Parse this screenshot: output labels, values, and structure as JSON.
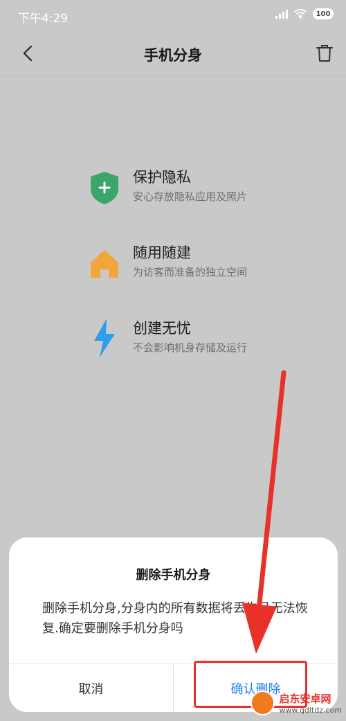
{
  "status": {
    "time": "下午4:29",
    "battery": "100"
  },
  "nav": {
    "title": "手机分身"
  },
  "features": [
    {
      "title": "保护隐私",
      "subtitle": "安心存放隐私应用及照片"
    },
    {
      "title": "随用随建",
      "subtitle": "为访客而准备的独立空间"
    },
    {
      "title": "创建无忧",
      "subtitle": "不会影响机身存储及运行"
    }
  ],
  "dialog": {
    "title": "删除手机分身",
    "message": "删除手机分身,分身内的所有数据将丢失且无法恢复.确定要删除手机分身吗",
    "cancel": "取消",
    "confirm": "确认删除"
  },
  "watermark": {
    "name": "启东安卓网",
    "url": "www.qdltdz.com"
  },
  "colors": {
    "accent": "#1f7cf0",
    "shield": "#3aa66b",
    "house": "#f0a63a",
    "bolt": "#2f9ee8",
    "annotation": "#e8312b"
  }
}
